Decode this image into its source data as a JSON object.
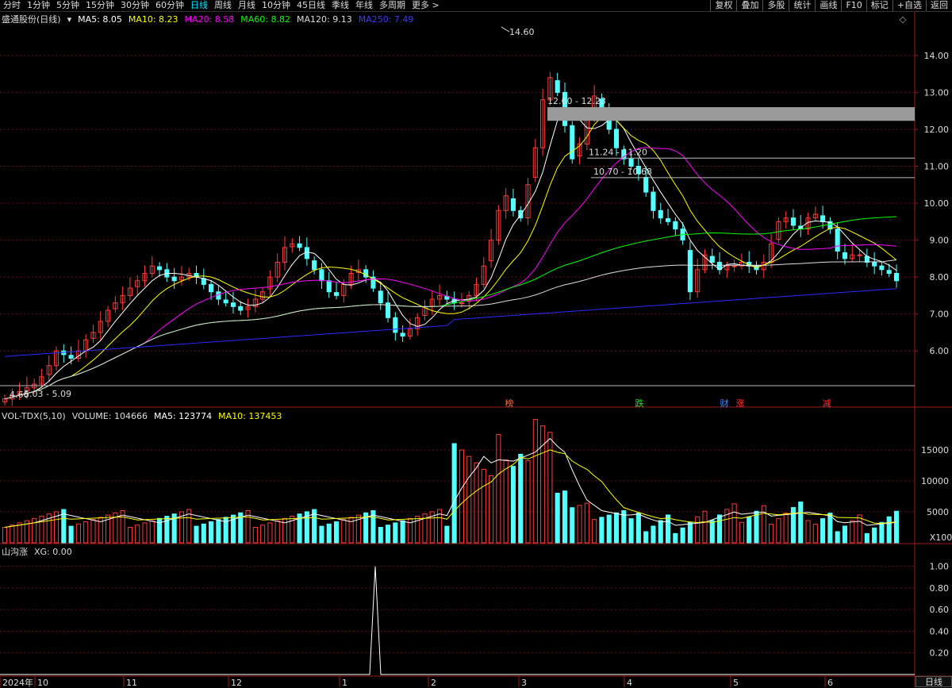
{
  "toolbar": {
    "periods": [
      "分时",
      "1分钟",
      "5分钟",
      "15分钟",
      "30分钟",
      "60分钟",
      "日线",
      "周线",
      "月线",
      "10分钟",
      "45日线",
      "季线",
      "年线",
      "多周期",
      "更多 >"
    ],
    "active_period": "日线",
    "right_buttons": [
      "复权",
      "叠加",
      "多股",
      "统计",
      "画线",
      "F10",
      "标记",
      "+自选",
      "返回"
    ]
  },
  "price_legend": {
    "title": "盛通股份(日线)",
    "ma5": "MA5: 8.05",
    "ma10": "MA10: 8.23",
    "ma20": "MA20: 8.58",
    "ma60": "MA60: 8.82",
    "ma120": "MA120: 9.13",
    "ma250": "MA250: 7.49"
  },
  "volume_legend": {
    "title": "VOL-TDX(5,10)",
    "volume": "VOLUME: 104666",
    "ma5": "MA5: 123774",
    "ma10": "MA10: 137453"
  },
  "indicator_legend": {
    "title": "山沟涨",
    "xg": "XG: 0.00"
  },
  "price_axis": [
    "14.00",
    "13.00",
    "12.00",
    "11.00",
    "10.00",
    "9.00",
    "8.00",
    "7.00",
    "6.00"
  ],
  "volume_axis": [
    "15000",
    "10000",
    "5000"
  ],
  "volume_unit": "X100",
  "indicator_axis": [
    "1.00",
    "0.80",
    "0.60",
    "0.40",
    "0.20"
  ],
  "date_axis": [
    "2024年",
    "10",
    "11",
    "12",
    "1",
    "2",
    "3",
    "4",
    "5",
    "6"
  ],
  "period_label": "日线",
  "annotations": {
    "high": "14.60",
    "low": "4.66",
    "zone1": "12.60 - 12.23",
    "zone2": "11.24 - 11.20",
    "zone3": "10.70 - 10.68",
    "zone4": "5.03 - 5.09"
  },
  "event_markers": [
    {
      "text": "榜",
      "color": "#ff6a3d"
    },
    {
      "text": "跌",
      "color": "#33dd33"
    },
    {
      "text": "财",
      "color": "#3a8dff"
    },
    {
      "text": "涨",
      "color": "#ff3333"
    },
    {
      "text": "减",
      "color": "#ff3333"
    }
  ],
  "colors": {
    "up": "#ff3b3b",
    "down": "#54ffff",
    "ma5": "#ffffff",
    "ma10": "#ffff00",
    "ma20": "#ff00ff",
    "ma60": "#00ff00",
    "ma120": "#dddddd",
    "ma250": "#2b2bff"
  },
  "chart_data": {
    "type": "candlestick",
    "ohlc_close_approx": [
      4.7,
      4.8,
      4.9,
      5.0,
      5.1,
      5.3,
      5.6,
      6.0,
      5.9,
      5.8,
      6.0,
      6.3,
      6.5,
      6.8,
      7.1,
      7.3,
      7.5,
      7.7,
      7.9,
      8.1,
      8.3,
      8.2,
      8.0,
      7.9,
      8.0,
      8.1,
      8.0,
      7.8,
      7.6,
      7.4,
      7.3,
      7.2,
      7.1,
      7.2,
      7.4,
      7.6,
      8.0,
      8.4,
      8.8,
      8.9,
      8.8,
      8.5,
      8.2,
      7.9,
      7.6,
      7.5,
      7.8,
      8.1,
      8.2,
      8.0,
      7.7,
      7.3,
      6.9,
      6.5,
      6.4,
      6.6,
      6.9,
      7.2,
      7.4,
      7.5,
      7.4,
      7.3,
      7.3,
      7.5,
      7.8,
      8.3,
      9.0,
      9.8,
      10.2,
      9.8,
      9.6,
      10.5,
      11.5,
      12.8,
      13.4,
      13.0,
      12.1,
      11.2,
      11.6,
      12.3,
      12.9,
      12.5,
      12.0,
      11.5,
      11.2,
      11.0,
      10.8,
      10.3,
      9.8,
      9.6,
      9.5,
      9.3,
      9.0,
      7.6,
      8.2,
      8.6,
      8.4,
      8.2,
      8.3,
      8.3,
      8.4,
      8.3,
      8.2,
      8.4,
      8.9,
      9.5,
      9.6,
      9.4,
      9.3,
      9.6,
      9.7,
      9.5,
      9.3,
      8.7,
      8.5,
      8.6,
      8.6,
      8.4,
      8.3,
      8.2,
      8.1,
      7.9
    ],
    "price_ylim": [
      4.5,
      14.9
    ],
    "volume_ylim": [
      0,
      19500
    ],
    "indicator_ylim": [
      0,
      1.1
    ]
  }
}
